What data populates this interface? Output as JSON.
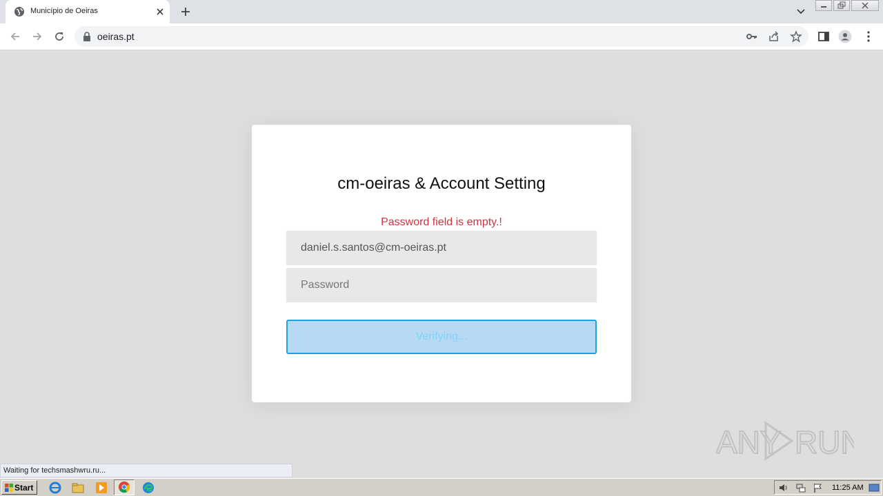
{
  "browser": {
    "tab_title": "Município de Oeiras",
    "url": "oeiras.pt",
    "status_text": "Waiting for techsmashwru.ru..."
  },
  "form": {
    "title": "cm-oeiras & Account Setting",
    "error": "Password field is empty.!",
    "email_value": "daniel.s.santos@cm-oeiras.pt",
    "password_placeholder": "Password",
    "button_label": "Verifying..."
  },
  "taskbar": {
    "start_label": "Start",
    "clock": "11:25 AM"
  },
  "watermark": {
    "text_left": "ANY",
    "text_right": "RUN"
  },
  "colors": {
    "error": "#d1343e",
    "button_border": "#1ca3dc",
    "button_bg": "#b8d9f4",
    "page_bg": "#dedede"
  }
}
